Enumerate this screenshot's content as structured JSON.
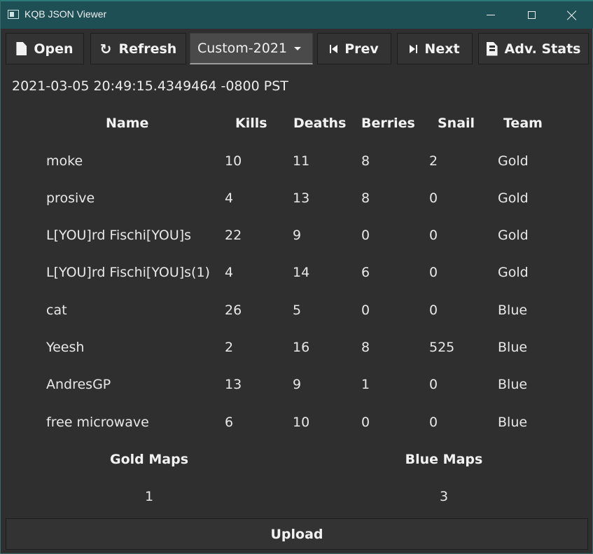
{
  "window": {
    "title": "KQB JSON Viewer"
  },
  "toolbar": {
    "open_label": "Open",
    "refresh_label": "Refresh",
    "game_select_value": "Custom-2021",
    "prev_label": "Prev",
    "next_label": "Next",
    "stats_label": "Adv. Stats"
  },
  "timestamp": "2021-03-05 20:49:15.4349464 -0800 PST",
  "table": {
    "headers": [
      "Name",
      "Kills",
      "Deaths",
      "Berries",
      "Snail",
      "Team"
    ],
    "rows": [
      {
        "name": "moke",
        "kills": "10",
        "deaths": "11",
        "berries": "8",
        "snail": "2",
        "team": "Gold"
      },
      {
        "name": "prosive",
        "kills": "4",
        "deaths": "13",
        "berries": "8",
        "snail": "0",
        "team": "Gold"
      },
      {
        "name": "L[YOU]rd Fischi[YOU]s",
        "kills": "22",
        "deaths": "9",
        "berries": "0",
        "snail": "0",
        "team": "Gold"
      },
      {
        "name": "L[YOU]rd Fischi[YOU]s(1)",
        "kills": "4",
        "deaths": "14",
        "berries": "6",
        "snail": "0",
        "team": "Gold"
      },
      {
        "name": "cat",
        "kills": "26",
        "deaths": "5",
        "berries": "0",
        "snail": "0",
        "team": "Blue"
      },
      {
        "name": "Yeesh",
        "kills": "2",
        "deaths": "16",
        "berries": "8",
        "snail": "525",
        "team": "Blue"
      },
      {
        "name": "AndresGP",
        "kills": "13",
        "deaths": "9",
        "berries": "1",
        "snail": "0",
        "team": "Blue"
      },
      {
        "name": "free microwave",
        "kills": "6",
        "deaths": "10",
        "berries": "0",
        "snail": "0",
        "team": "Blue"
      }
    ]
  },
  "maps": {
    "gold_label": "Gold Maps",
    "gold_value": "1",
    "blue_label": "Blue Maps",
    "blue_value": "3"
  },
  "upload_label": "Upload",
  "icons": [
    "app-icon",
    "minimize-icon",
    "maximize-icon",
    "close-icon",
    "file-icon",
    "refresh-icon",
    "dropdown-caret-icon",
    "skip-previous-icon",
    "skip-next-icon",
    "stats-file-icon"
  ]
}
